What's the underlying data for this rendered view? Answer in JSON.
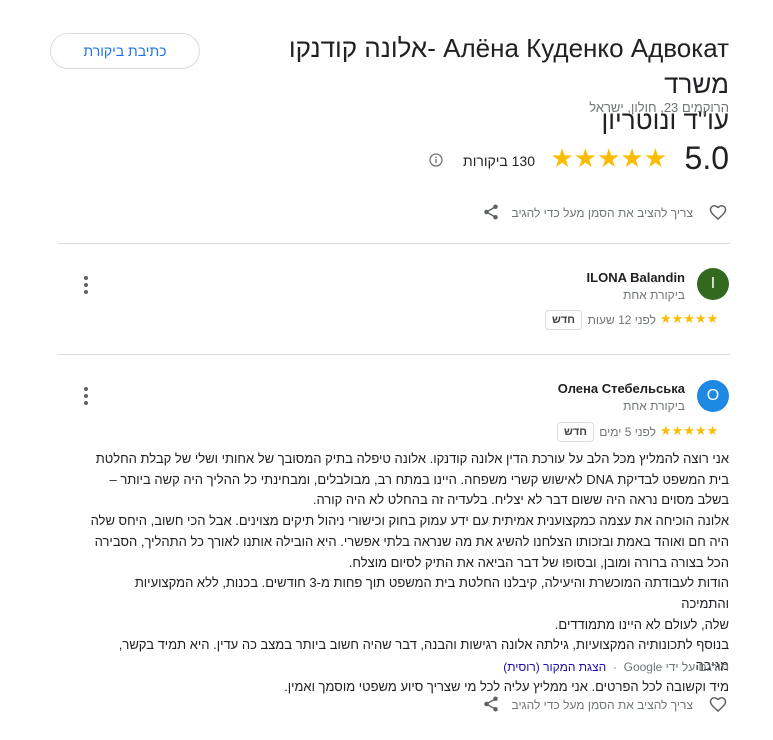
{
  "header": {
    "write_review_label": "כתיבת ביקורת",
    "title_line1": "Алёна Куденко Адвокат -אלונה קודנקו משרד",
    "title_line2": "עו\"ד ונוטריון",
    "address": "הרוקמים 23, חולון, ישראל",
    "rating": "5.0",
    "stars": 5,
    "review_count": "130 ביקורות",
    "info_icon": "info-icon"
  },
  "action_row": {
    "helpful_text": "צריך להציב את הסמן מעל כדי להגיב",
    "heart_icon": "heart-outline-icon",
    "share_icon": "share-icon"
  },
  "reviews": [
    {
      "author": "ILONA Balandin",
      "avatar_letter": "I",
      "avatar_color": "#33691e",
      "meta": "ביקורת אחת",
      "stars": 5,
      "time": "לפני 12 שעות",
      "badge": "חדש"
    },
    {
      "author": "Олена Стебельська",
      "avatar_letter": "О",
      "avatar_color": "#1e88e5",
      "meta": "ביקורת אחת",
      "stars": 5,
      "time": "לפני 5 ימים",
      "badge": "חדש",
      "body": [
        "אני רוצה להמליץ מכל הלב על עורכת הדין אלונה קודנקו. אלונה טיפלה בתיק המסובך של אחותי ושלי של קבלת החלטת",
        "בית המשפט לבדיקת DNA לאישוש קשרי משפחה. היינו במתח רב, מבולבלים, ומבחינתי כל ההליך היה קשה ביותר –",
        "בשלב מסוים נראה היה ששום דבר לא יצליח. בלעדיה זה בהחלט לא היה קורה.",
        "אלונה הוכיחה את עצמה כמקצוענית אמיתית עם ידע עמוק בחוק וכישורי ניהול תיקים מצוינים. אבל הכי חשוב, היחס שלה",
        "היה חם ואוהד באמת ובזכותו הצלחנו להשיג את מה שנראה בלתי אפשרי. היא הובילה אותנו לאורך כל התהליך, הסבירה",
        "הכל בצורה ברורה ומובן, ובסופו של דבר הביאה את התיק לסיום מוצלח.",
        "הודות לעבודתה המוכשרת והיעילה, קיבלנו החלטת בית המשפט תוך פחות מ-3 חודשים. בכנות, ללא המקצועיות והתמיכה",
        "שלה, לעולם לא היינו מתמודדים.",
        "בנוסף לתכונותיה המקצועיות, גילתה אלונה רגישות והבנה, דבר שהיה חשוב ביותר במצב כה עדין. היא תמיד בקשר, מגיבה",
        "מיד וקשובה לכל הפרטים. אני ממליץ עליה לכל מי שצריך סיוע משפטי מוסמך ואמין."
      ],
      "translated_by": "תורגם על ידי Google",
      "show_original": "הצגת המקור (רוסית)"
    }
  ],
  "colors": {
    "star": "#fbbc04",
    "accent": "#1a73e8",
    "link": "#1a0dab"
  }
}
